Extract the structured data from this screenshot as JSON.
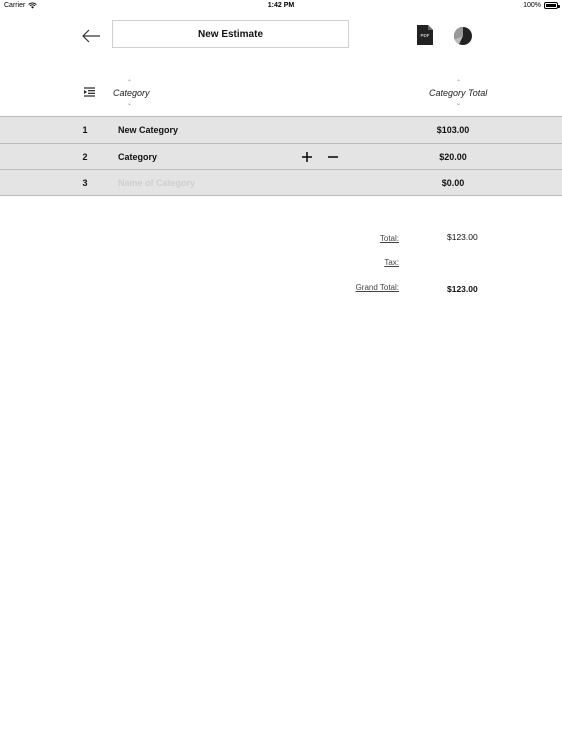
{
  "status_bar": {
    "carrier": "Carrier",
    "time": "1:42 PM",
    "battery": "100%"
  },
  "header": {
    "title": "New Estimate",
    "pdf_label": "PDF"
  },
  "columns": {
    "category": "Category",
    "total": "Category Total"
  },
  "rows": [
    {
      "num": "1",
      "name": "New Category",
      "total": "$103.00"
    },
    {
      "num": "2",
      "name": "Category",
      "total": "$20.00"
    },
    {
      "num": "3",
      "placeholder": "Name of Category",
      "total": "$0.00"
    }
  ],
  "summary": {
    "total_label": "Total:",
    "total_value": "$123.00",
    "tax_label": "Tax:",
    "grand_total_label": "Grand Total:",
    "grand_total_value": "$123.00"
  },
  "icons": {
    "back": "arrow-left-icon",
    "pdf": "pdf-icon",
    "chart": "pie-chart-icon",
    "reorder": "reorder-icon",
    "plus": "plus-icon",
    "minus": "minus-icon"
  }
}
